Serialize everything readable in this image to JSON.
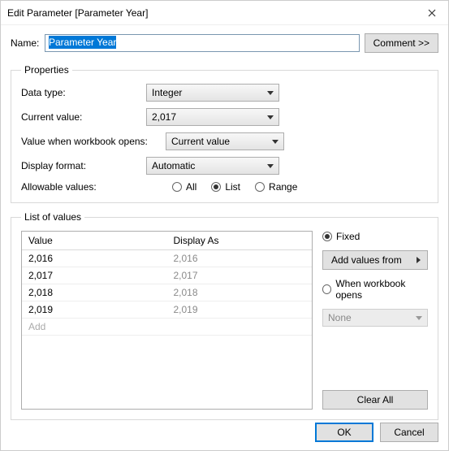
{
  "window": {
    "title": "Edit Parameter [Parameter Year]"
  },
  "name": {
    "label": "Name:",
    "value": "Parameter Year"
  },
  "commentBtn": "Comment >>",
  "properties": {
    "legend": "Properties",
    "dataType": {
      "label": "Data type:",
      "value": "Integer"
    },
    "currentValue": {
      "label": "Current value:",
      "value": "2,017"
    },
    "valueWhenOpens": {
      "label": "Value when workbook opens:",
      "value": "Current value"
    },
    "displayFormat": {
      "label": "Display format:",
      "value": "Automatic"
    },
    "allowable": {
      "label": "Allowable values:",
      "options": {
        "all": "All",
        "list": "List",
        "range": "Range"
      },
      "selected": "list"
    }
  },
  "listOfValues": {
    "legend": "List of values",
    "headers": {
      "value": "Value",
      "displayAs": "Display As"
    },
    "rows": [
      {
        "value": "2,016",
        "displayAs": "2,016"
      },
      {
        "value": "2,017",
        "displayAs": "2,017"
      },
      {
        "value": "2,018",
        "displayAs": "2,018"
      },
      {
        "value": "2,019",
        "displayAs": "2,019"
      }
    ],
    "addLabel": "Add",
    "side": {
      "fixed": "Fixed",
      "addValuesFrom": "Add values from",
      "whenWbOpens": "When workbook opens",
      "noneOption": "None",
      "clearAll": "Clear All",
      "selected": "fixed"
    }
  },
  "footer": {
    "ok": "OK",
    "cancel": "Cancel"
  }
}
